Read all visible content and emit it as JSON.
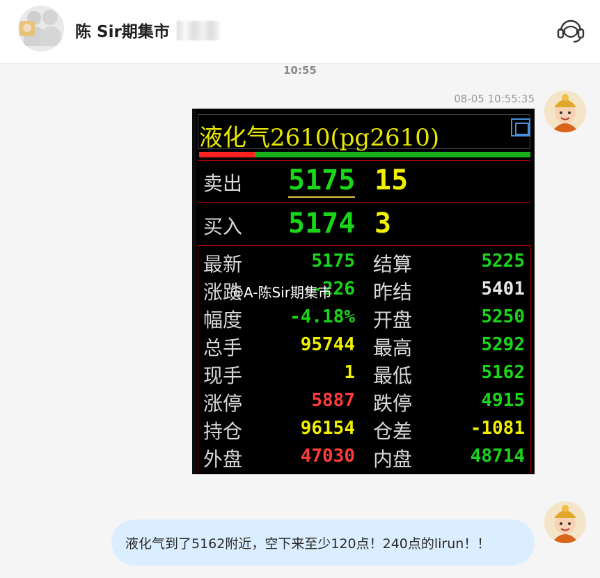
{
  "header": {
    "title": "陈 Sir期集市",
    "icons": {
      "group_avatar": "group-avatar-icon",
      "support": "customer-service-icon"
    }
  },
  "time_separator": "10:55",
  "messages": [
    {
      "time": "08-05 10:55:35",
      "type": "image"
    },
    {
      "type": "text",
      "text": "液化气到了5162附近，空下来至少120点！240点的lirun！！"
    }
  ],
  "quote": {
    "title": "液化气2610(pg2610)",
    "sell_label": "卖出",
    "sell_price": "5175",
    "sell_vol": "15",
    "buy_label": "买入",
    "buy_price": "5174",
    "buy_vol": "3",
    "rows_left": [
      {
        "label": "最新",
        "value": "5175",
        "color": "#19d619"
      },
      {
        "label": "涨跌",
        "value": "-226",
        "color": "#19d619"
      },
      {
        "label": "幅度",
        "value": "-4.18%",
        "color": "#19d619"
      },
      {
        "label": "总手",
        "value": "95744",
        "color": "#f0f000"
      },
      {
        "label": "现手",
        "value": "1",
        "color": "#f0f000"
      },
      {
        "label": "涨停",
        "value": "5887",
        "color": "#ff3b3b"
      },
      {
        "label": "持仓",
        "value": "96154",
        "color": "#f0f000"
      },
      {
        "label": "外盘",
        "value": "47030",
        "color": "#ff3b3b"
      }
    ],
    "rows_right": [
      {
        "label": "结算",
        "value": "5225",
        "color": "#19d619"
      },
      {
        "label": "昨结",
        "value": "5401",
        "color": "#e8e8e8"
      },
      {
        "label": "开盘",
        "value": "5250",
        "color": "#19d619"
      },
      {
        "label": "最高",
        "value": "5292",
        "color": "#19d619"
      },
      {
        "label": "最低",
        "value": "5162",
        "color": "#19d619"
      },
      {
        "label": "跌停",
        "value": "4915",
        "color": "#19d619"
      },
      {
        "label": "仓差",
        "value": "-1081",
        "color": "#f0f000"
      },
      {
        "label": "内盘",
        "value": "48714",
        "color": "#19d619"
      }
    ],
    "watermark": "@A-陈Sir期集市"
  }
}
